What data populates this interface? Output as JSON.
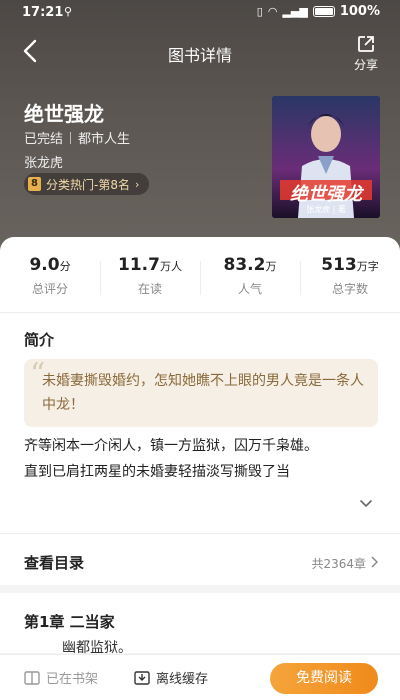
{
  "status_bar": {
    "time": "17:21",
    "signal": "⏚",
    "battery": "100%"
  },
  "nav": {
    "title": "图书详情",
    "share_label": "分享"
  },
  "book": {
    "title": "绝世强龙",
    "status": "已完结",
    "category": "都市人生",
    "author": "张龙虎",
    "rank_badge": "8",
    "rank_text": "分类热门-第8名",
    "cover_title": "绝世强龙",
    "cover_author": "张龙虎 | 著"
  },
  "stats": [
    {
      "value": "9.0",
      "unit": "分",
      "label": "总评分"
    },
    {
      "value": "11.7",
      "unit": "万人",
      "label": "在读"
    },
    {
      "value": "83.2",
      "unit": "万",
      "label": "人气"
    },
    {
      "value": "513",
      "unit": "万字",
      "label": "总字数"
    }
  ],
  "synopsis": {
    "title": "简介",
    "quote": "未婚妻撕毁婚约，怎知她瞧不上眼的男人竟是一条人中龙！",
    "para1": "齐等闲本一介闲人，镇一方监狱，囚万千枭雄。",
    "para2": "直到已肩扛两星的未婚妻轻描淡写撕毁了当"
  },
  "toc": {
    "label": "查看目录",
    "count": "共2364章"
  },
  "chapter": {
    "title": "第1章 二当家",
    "excerpt": "幽都监狱。"
  },
  "bottom": {
    "on_shelf": "已在书架",
    "offline": "离线缓存",
    "read": "免费阅读"
  },
  "colors": {
    "accent": "#f08a1c",
    "quote_bg": "#f5efe6",
    "quote_text": "#8a6a3a",
    "rank_text": "#f2d9a8"
  }
}
